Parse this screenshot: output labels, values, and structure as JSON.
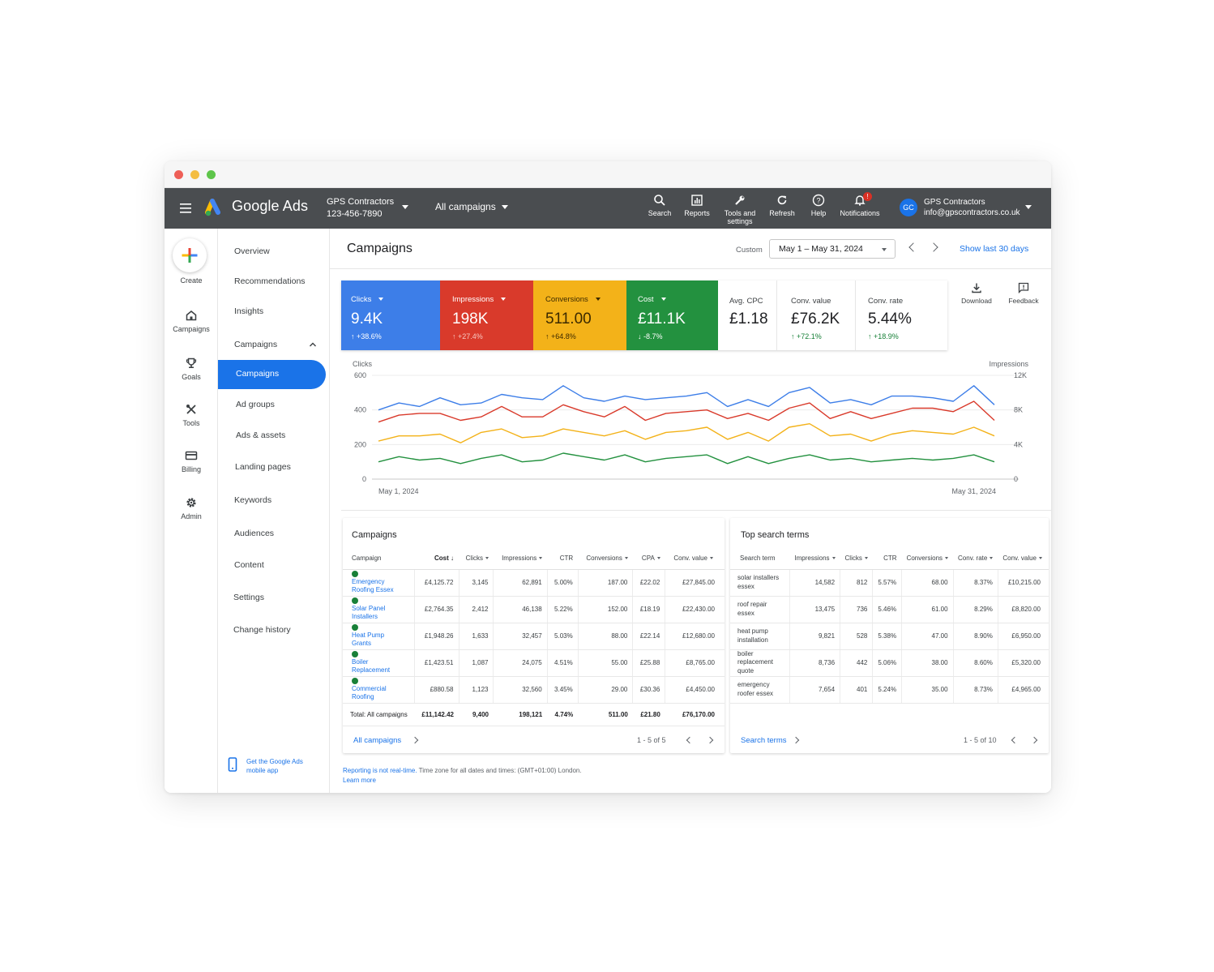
{
  "topbar": {
    "brand": "Google Ads",
    "account_name": "GPS Contractors",
    "account_id": "123-456-7890",
    "campaign_selector": "All campaigns",
    "icons": [
      {
        "name": "search-icon",
        "label": "Search"
      },
      {
        "name": "reports-icon",
        "label": "Reports"
      },
      {
        "name": "tools-icon",
        "label": "Tools and settings"
      },
      {
        "name": "refresh-icon",
        "label": "Refresh"
      },
      {
        "name": "help-icon",
        "label": "Help"
      },
      {
        "name": "notifications-icon",
        "label": "Notifications",
        "badge": "!"
      }
    ],
    "user_initials": "GC",
    "user_name": "GPS Contractors",
    "user_email": "info@gpscontractors.co.uk"
  },
  "rail": {
    "create": "Create",
    "items": [
      {
        "icon": "home-icon",
        "label": "Campaigns"
      },
      {
        "icon": "trophy-icon",
        "label": "Goals"
      },
      {
        "icon": "tools-icon",
        "label": "Tools"
      },
      {
        "icon": "card-icon",
        "label": "Billing"
      },
      {
        "icon": "gear-icon",
        "label": "Admin"
      }
    ]
  },
  "subnav": {
    "items": [
      "Overview",
      "Recommendations",
      "Insights",
      "Campaigns",
      "Campaigns",
      "Ad groups",
      "Ads & assets",
      "Landing pages",
      "Keywords",
      "Audiences",
      "Content",
      "Settings",
      "Change history"
    ],
    "get_app": "Get the Google Ads mobile app"
  },
  "header": {
    "title": "Campaigns",
    "custom_label": "Custom",
    "date_range": "May 1 – May 31, 2024",
    "show_last": "Show last 30 days"
  },
  "metrics": [
    {
      "label": "Clicks",
      "value": "9.4K",
      "change": "+38.6%",
      "color": "#3d7ee8"
    },
    {
      "label": "Impressions",
      "value": "198K",
      "change": "+27.4%",
      "color": "#d93a2b"
    },
    {
      "label": "Conversions",
      "value": "511.00",
      "change": "+64.8%",
      "color": "#f3b219"
    },
    {
      "label": "Cost",
      "value": "£11.1K",
      "change": "-8.7%",
      "color": "#23913f"
    },
    {
      "label": "Avg. CPC",
      "value": "£1.18",
      "change": ""
    },
    {
      "label": "Conv. value",
      "value": "£76.2K",
      "change": "+72.1%"
    },
    {
      "label": "Conv. rate",
      "value": "5.44%",
      "change": "+18.9%"
    }
  ],
  "tools": {
    "download": "Download",
    "feedback": "Feedback"
  },
  "chart_data": {
    "type": "line",
    "xlabel": "",
    "y_left_label": "Clicks",
    "y_right_label": "Impressions",
    "y_left_ticks": [
      "600",
      "400",
      "200",
      "0"
    ],
    "y_right_ticks": [
      "12K",
      "8K",
      "4K",
      "0"
    ],
    "x_start_label": "May 1, 2024",
    "x_end_label": "May 31, 2024",
    "ylim": [
      0,
      600
    ],
    "series": [
      {
        "color": "#3d7ee8",
        "values": [
          400,
          440,
          420,
          470,
          430,
          440,
          490,
          470,
          460,
          540,
          470,
          450,
          480,
          460,
          470,
          480,
          500,
          420,
          460,
          420,
          500,
          530,
          440,
          460,
          430,
          480,
          480,
          470,
          450,
          540,
          430
        ]
      },
      {
        "color": "#d93a2b",
        "values": [
          330,
          370,
          380,
          380,
          340,
          360,
          420,
          360,
          360,
          430,
          390,
          360,
          420,
          340,
          380,
          390,
          400,
          350,
          380,
          340,
          410,
          440,
          350,
          390,
          350,
          380,
          410,
          410,
          390,
          450,
          340
        ]
      },
      {
        "color": "#f3b219",
        "values": [
          220,
          250,
          250,
          260,
          210,
          270,
          290,
          240,
          250,
          290,
          270,
          250,
          280,
          230,
          270,
          280,
          300,
          230,
          270,
          220,
          300,
          320,
          250,
          260,
          220,
          260,
          280,
          270,
          260,
          300,
          250
        ]
      },
      {
        "color": "#23913f",
        "values": [
          100,
          130,
          110,
          120,
          90,
          120,
          140,
          100,
          110,
          150,
          130,
          110,
          140,
          100,
          120,
          130,
          140,
          90,
          130,
          90,
          120,
          140,
          110,
          120,
          100,
          110,
          120,
          110,
          120,
          140,
          100
        ]
      }
    ]
  },
  "campaigns_card": {
    "title": "Campaigns",
    "columns": [
      "Campaign",
      "Cost",
      "Clicks",
      "Impressions",
      "CTR",
      "Conversions",
      "CPA",
      "Conv. value"
    ],
    "rows": [
      [
        "Emergency Roofing Essex",
        "£4,125.72",
        "3,145",
        "62,891",
        "5.00%",
        "187.00",
        "£22.02",
        "£27,845.00"
      ],
      [
        "Solar Panel Installers",
        "£2,764.35",
        "2,412",
        "46,138",
        "5.22%",
        "152.00",
        "£18.19",
        "£22,430.00"
      ],
      [
        "Heat Pump Grants",
        "£1,948.26",
        "1,633",
        "32,457",
        "5.03%",
        "88.00",
        "£22.14",
        "£12,680.00"
      ],
      [
        "Boiler Replacement",
        "£1,423.51",
        "1,087",
        "24,075",
        "4.51%",
        "55.00",
        "£25.88",
        "£8,765.00"
      ],
      [
        "Commercial Roofing",
        "£880.58",
        "1,123",
        "32,560",
        "3.45%",
        "29.00",
        "£30.36",
        "£4,450.00"
      ]
    ],
    "total": [
      "Total: All campaigns",
      "£11,142.42",
      "9,400",
      "198,121",
      "4.74%",
      "511.00",
      "£21.80",
      "£76,170.00"
    ],
    "footer_link": "All campaigns",
    "count": "1 - 5 of 5"
  },
  "search_card": {
    "title": "Top search terms",
    "columns": [
      "Search term",
      "Impressions",
      "Clicks",
      "CTR",
      "Conversions",
      "Conv. rate",
      "Conv. value"
    ],
    "rows": [
      [
        "solar installers essex",
        "14,582",
        "812",
        "5.57%",
        "68.00",
        "8.37%",
        "£10,215.00"
      ],
      [
        "roof repair essex",
        "13,475",
        "736",
        "5.46%",
        "61.00",
        "8.29%",
        "£8,820.00"
      ],
      [
        "heat pump installation",
        "9,821",
        "528",
        "5.38%",
        "47.00",
        "8.90%",
        "£6,950.00"
      ],
      [
        "boiler replacement quote",
        "8,736",
        "442",
        "5.06%",
        "38.00",
        "8.60%",
        "£5,320.00"
      ],
      [
        "emergency roofer essex",
        "7,654",
        "401",
        "5.24%",
        "35.00",
        "8.73%",
        "£4,965.00"
      ]
    ],
    "footer_link": "Search terms",
    "count": "1 - 5 of 10"
  },
  "footnote": {
    "link1": "Reporting is not real-time.",
    "text": " Time zone for all dates and times: (GMT+01:00) London.",
    "link2": "Learn more"
  }
}
